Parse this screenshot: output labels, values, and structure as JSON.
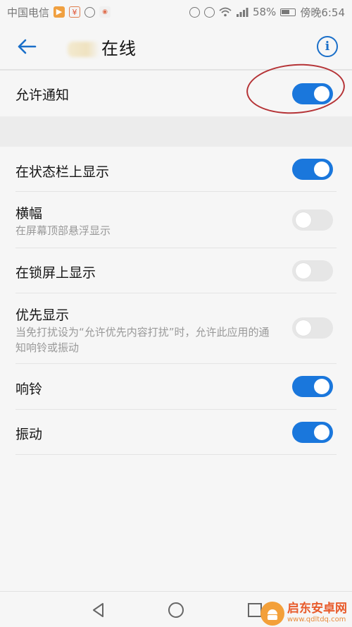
{
  "status_bar": {
    "carrier": "中国电信",
    "battery": "58%",
    "time": "傍晚6:54",
    "icons": [
      "notification-icon",
      "app-icon",
      "app-icon",
      "wechat-icon",
      "rotation-lock-icon",
      "alarm-icon",
      "wifi-icon",
      "signal-icon",
      "battery-icon"
    ]
  },
  "header": {
    "title": "在线",
    "back_icon": "back-arrow-icon",
    "info_icon": "info-icon"
  },
  "settings": {
    "allow_notifications": {
      "label": "允许通知",
      "on": true
    },
    "status_bar_display": {
      "label": "在状态栏上显示",
      "on": true
    },
    "banner": {
      "label": "横幅",
      "sub": "在屏幕顶部悬浮显示",
      "on": false
    },
    "lock_screen": {
      "label": "在锁屏上显示",
      "on": false
    },
    "priority": {
      "label": "优先显示",
      "sub": "当免打扰设为“允许优先内容打扰”时，允许此应用的通知响铃或振动",
      "on": false
    },
    "ringtone": {
      "label": "响铃",
      "on": true
    },
    "vibrate": {
      "label": "振动",
      "on": true
    }
  },
  "colors": {
    "toggle_on": "#1a77dc",
    "toggle_off": "#e6e6e6",
    "accent": "#1a6fc9",
    "annotation": "#b53336"
  },
  "watermark": {
    "name": "启东安卓网",
    "url": "www.qdltdq.com"
  }
}
